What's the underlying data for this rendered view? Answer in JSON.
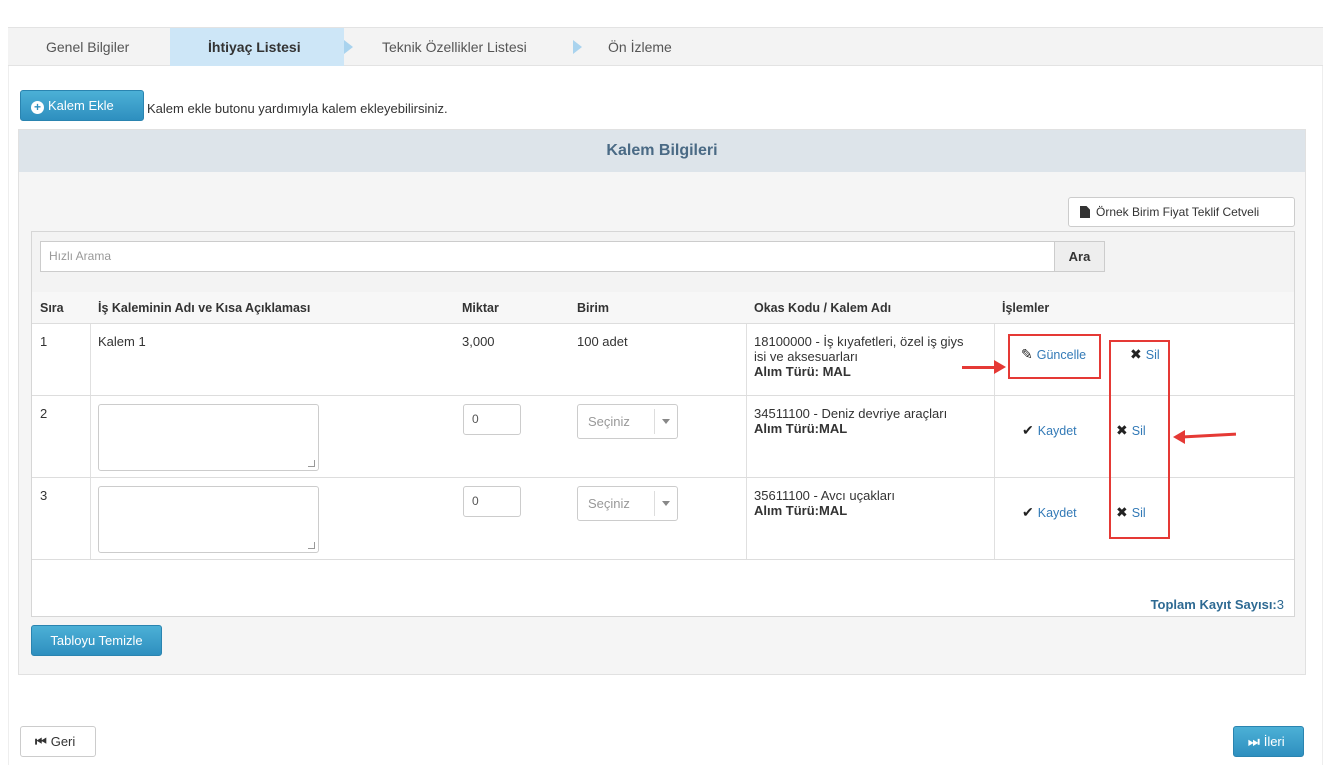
{
  "wizard": {
    "steps": [
      "Genel Bilgiler",
      "İhtiyaç Listesi",
      "Teknik Özellikler Listesi",
      "Ön İzleme"
    ],
    "active_index": 1
  },
  "toolbar": {
    "add_item_label": "Kalem Ekle",
    "add_item_hint": "Kalem ekle butonu yardımıyla kalem ekleyebilirsiniz."
  },
  "panel": {
    "title": "Kalem Bilgileri",
    "sample_button_label": "Örnek Birim Fiyat Teklif Cetveli"
  },
  "search": {
    "placeholder": "Hızlı Arama",
    "button_label": "Ara"
  },
  "table": {
    "headers": [
      "Sıra",
      "İş Kaleminin Adı ve Kısa Açıklaması",
      "Miktar",
      "Birim",
      "Okas Kodu / Kalem Adı",
      "İşlemler"
    ],
    "rows": [
      {
        "index": "1",
        "name": "Kalem 1",
        "quantity": "3,000",
        "unit": "100 adet",
        "okas_line1": "18100000 - İş kıyafetleri, özel iş giys",
        "okas_line2": "isi ve aksesuarları",
        "okas_type": "Alım Türü: MAL",
        "action_primary": "Güncelle",
        "action_delete": "Sil"
      },
      {
        "index": "2",
        "quantity_value": "0",
        "unit_placeholder": "Seçiniz",
        "okas_line1": "34511100 - Deniz devriye araçları",
        "okas_type": "Alım Türü:MAL",
        "action_primary": "Kaydet",
        "action_delete": "Sil"
      },
      {
        "index": "3",
        "quantity_value": "0",
        "unit_placeholder": "Seçiniz",
        "okas_line1": "35611100 - Avcı uçakları",
        "okas_type": "Alım Türü:MAL",
        "action_primary": "Kaydet",
        "action_delete": "Sil"
      }
    ],
    "total_label": "Toplam Kayıt Sayısı:",
    "total_value": "3"
  },
  "clear_table_label": "Tabloyu Temizle",
  "nav": {
    "back_label": "Geri",
    "next_label": "İleri"
  },
  "colors": {
    "accent_blue": "#2e8fbf",
    "active_step": "#cde6f7",
    "link": "#337ab7",
    "annotation_red": "#e53935"
  }
}
